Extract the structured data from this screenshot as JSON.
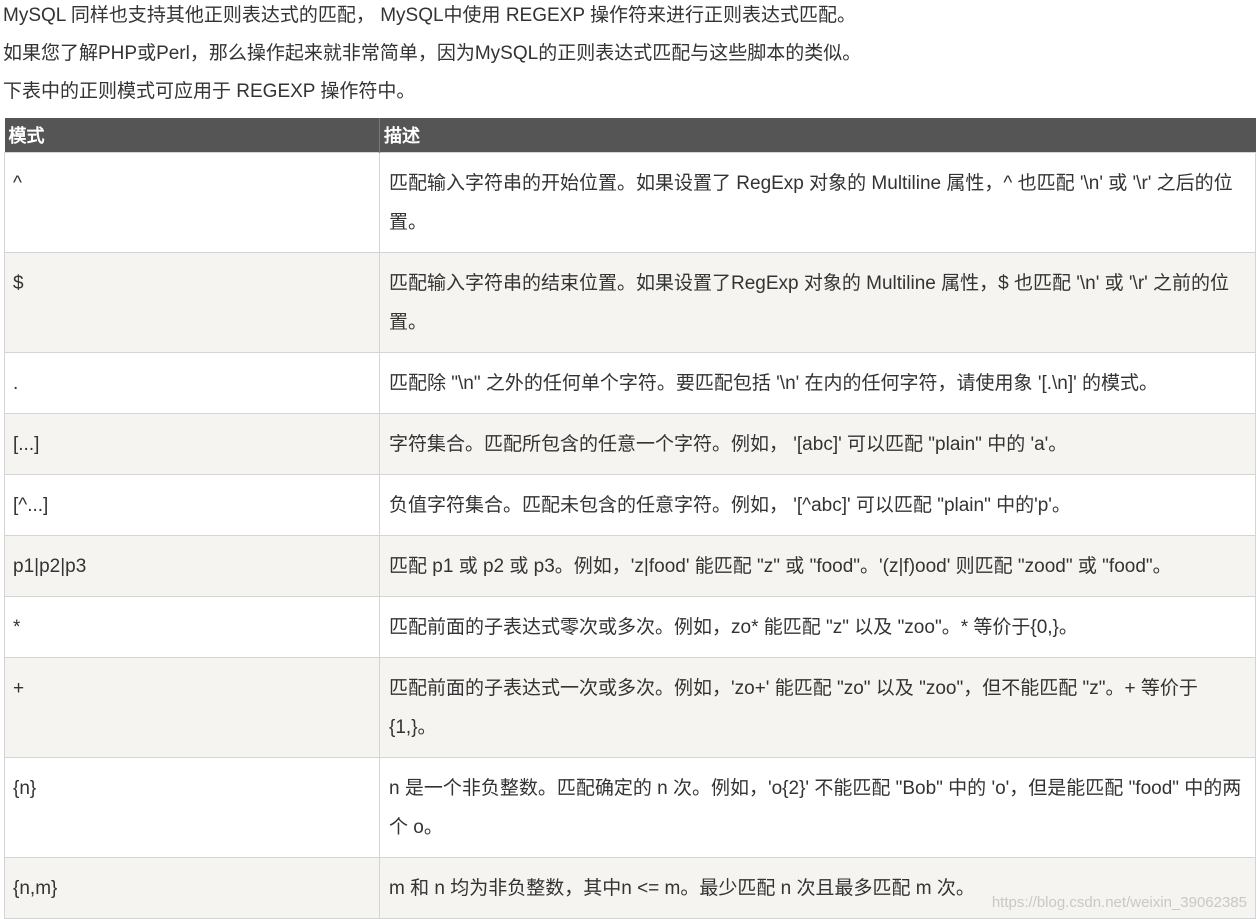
{
  "intro": {
    "line1": "MySQL 同样也支持其他正则表达式的匹配， MySQL中使用 REGEXP 操作符来进行正则表达式匹配。",
    "line2": "如果您了解PHP或Perl，那么操作起来就非常简单，因为MySQL的正则表达式匹配与这些脚本的类似。",
    "line3": "下表中的正则模式可应用于 REGEXP 操作符中。"
  },
  "table": {
    "headers": {
      "pattern": "模式",
      "description": "描述"
    },
    "rows": [
      {
        "pattern": "^",
        "description": "匹配输入字符串的开始位置。如果设置了 RegExp 对象的 Multiline 属性，^ 也匹配 '\\n' 或 '\\r' 之后的位置。"
      },
      {
        "pattern": "$",
        "description": "匹配输入字符串的结束位置。如果设置了RegExp 对象的 Multiline 属性，$ 也匹配 '\\n' 或 '\\r' 之前的位置。"
      },
      {
        "pattern": ".",
        "description": "匹配除 \"\\n\" 之外的任何单个字符。要匹配包括 '\\n' 在内的任何字符，请使用象 '[.\\n]' 的模式。"
      },
      {
        "pattern": "[...]",
        "description": "字符集合。匹配所包含的任意一个字符。例如， '[abc]' 可以匹配 \"plain\" 中的 'a'。"
      },
      {
        "pattern": "[^...]",
        "description": "负值字符集合。匹配未包含的任意字符。例如， '[^abc]' 可以匹配 \"plain\" 中的'p'。"
      },
      {
        "pattern": "p1|p2|p3",
        "description": "匹配 p1 或 p2 或 p3。例如，'z|food' 能匹配 \"z\" 或 \"food\"。'(z|f)ood' 则匹配 \"zood\" 或 \"food\"。"
      },
      {
        "pattern": "*",
        "description": "匹配前面的子表达式零次或多次。例如，zo* 能匹配 \"z\" 以及 \"zoo\"。* 等价于{0,}。"
      },
      {
        "pattern": "+",
        "description": "匹配前面的子表达式一次或多次。例如，'zo+' 能匹配 \"zo\" 以及 \"zoo\"，但不能匹配 \"z\"。+ 等价于 {1,}。"
      },
      {
        "pattern": "{n}",
        "description": "n 是一个非负整数。匹配确定的 n 次。例如，'o{2}' 不能匹配 \"Bob\" 中的 'o'，但是能匹配 \"food\" 中的两个 o。"
      },
      {
        "pattern": "{n,m}",
        "description": "m 和 n 均为非负整数，其中n <= m。最少匹配 n 次且最多匹配 m 次。"
      }
    ]
  },
  "watermark": "https://blog.csdn.net/weixin_39062385"
}
